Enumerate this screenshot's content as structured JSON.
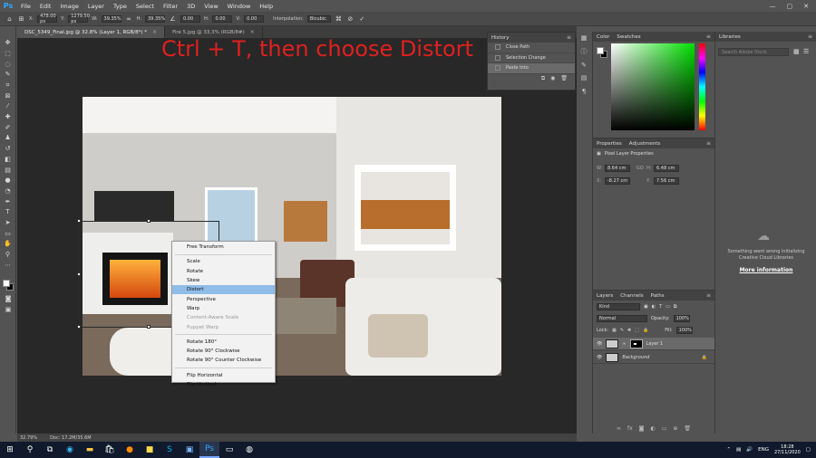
{
  "app": {
    "logo": "Ps"
  },
  "menu": [
    "File",
    "Edit",
    "Image",
    "Layer",
    "Type",
    "Select",
    "Filter",
    "3D",
    "View",
    "Window",
    "Help"
  ],
  "window_controls": [
    "—",
    "▢",
    "✕"
  ],
  "options": {
    "x_label": "X:",
    "x_value": "478.00 px",
    "y_label": "Y:",
    "y_value": "1279.50 px",
    "w_label": "W:",
    "w_value": "39.35%",
    "h_label": "H:",
    "h_value": "39.35%",
    "angle_value": "0.00",
    "hskew_label": "H:",
    "hskew_value": "0.00",
    "vskew_label": "V:",
    "vskew_value": "0.00",
    "interp_label": "Interpolation:",
    "interp_value": "Bicubic",
    "cancel_icon": "cancel-icon",
    "commit_icon": "checkmark-icon"
  },
  "tabs": [
    {
      "label": "DSC_5349_Final.jpg @ 32.8% (Layer 1, RGB/8*) *",
      "close": "×"
    },
    {
      "label": "Fire 5.jpg @ 33.3% (RGB/8#)",
      "close": "×"
    }
  ],
  "caption": "Ctrl + T, then choose Distort",
  "context_menu": {
    "free_transform": "Free Transform",
    "group1": [
      "Scale",
      "Rotate",
      "Skew",
      "Distort",
      "Perspective",
      "Warp",
      "Content-Aware Scale",
      "Puppet Warp"
    ],
    "selected": "Distort",
    "disabled": [
      "Content-Aware Scale",
      "Puppet Warp"
    ],
    "group2": [
      "Rotate 180°",
      "Rotate 90° Clockwise",
      "Rotate 90° Counter Clockwise"
    ],
    "group3": [
      "Flip Horizontal",
      "Flip Vertical"
    ]
  },
  "history": {
    "title": "History",
    "items": [
      "Close Path",
      "Selection Change",
      "Paste Into"
    ],
    "selected": "Paste Into"
  },
  "color_panel": {
    "tab1": "Color",
    "tab2": "Swatches",
    "hue_color": "#00e000"
  },
  "properties": {
    "tab1": "Properties",
    "tab2": "Adjustments",
    "heading": "Pixel Layer Properties",
    "w_label": "W:",
    "w_value": "8.64 cm",
    "h_label": "H:",
    "h_value": "6.48 cm",
    "x_label": "X:",
    "x_value": "-8.27 cm",
    "y_label": "Y:",
    "y_value": "7.56 cm",
    "link_icon": "GO"
  },
  "layers": {
    "tab1": "Layers",
    "tab2": "Channels",
    "tab3": "Paths",
    "search_placeholder": "Kind",
    "blend_mode": "Normal",
    "opacity_label": "Opacity:",
    "opacity_value": "100%",
    "lock_label": "Lock:",
    "fill_label": "Fill:",
    "fill_value": "100%",
    "list": [
      {
        "name": "Layer 1",
        "selected": true
      },
      {
        "name": "Background",
        "selected": false
      }
    ]
  },
  "libraries": {
    "title": "Libraries",
    "search_placeholder": "Search Adobe Stock",
    "message": "Something went wrong initializing Creative Cloud Libraries",
    "link": "More information"
  },
  "status": {
    "zoom": "32.79%",
    "doc": "Doc: 17.2M/35.6M"
  },
  "taskbar": {
    "lang": "ENG",
    "time": "18:28",
    "date": "27/11/2020"
  }
}
